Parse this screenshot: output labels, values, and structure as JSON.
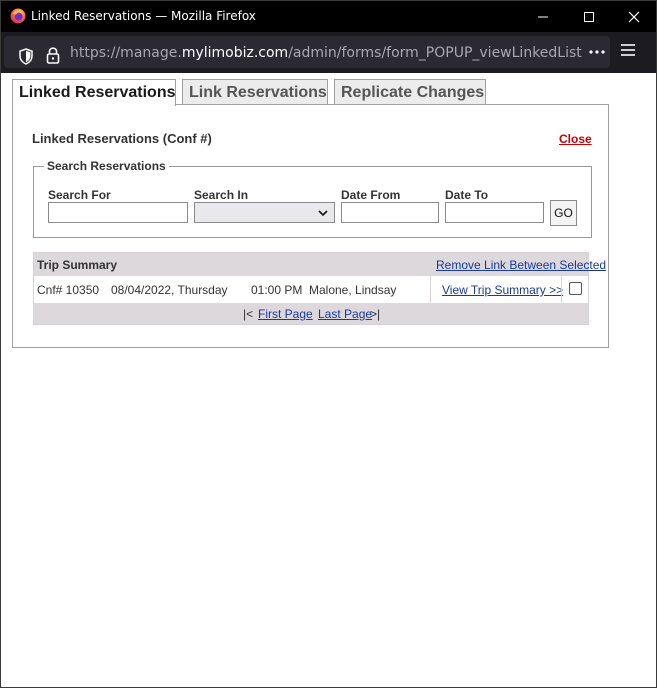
{
  "window": {
    "title": "Linked Reservations — Mozilla Firefox"
  },
  "urlbar": {
    "url_prefix": "https://manage.",
    "url_host": "mylimobiz.com",
    "url_suffix": "/admin/forms/form_POPUP_viewLinkedList.asp?action"
  },
  "tabs": [
    {
      "label": "Linked Reservations",
      "active": true
    },
    {
      "label": "Link Reservations",
      "active": false
    },
    {
      "label": "Replicate Changes",
      "active": false
    }
  ],
  "panel": {
    "title": "Linked Reservations (Conf #)",
    "close_label": "Close"
  },
  "search": {
    "legend": "Search Reservations",
    "search_for_label": "Search For",
    "search_for_value": "",
    "search_in_label": "Search In",
    "search_in_value": "",
    "date_from_label": "Date From",
    "date_from_value": "",
    "date_to_label": "Date To",
    "date_to_value": "",
    "go_label": "GO"
  },
  "results": {
    "header": "Trip Summary",
    "remove_link": "Remove Link Between Selected",
    "rows": [
      {
        "conf": "Cnf# 10350",
        "date": "08/04/2022, Thursday",
        "time": "01:00 PM",
        "name": "Malone, Lindsay",
        "view_link": "View Trip Summary >>",
        "checked": false
      }
    ],
    "pager": {
      "first_prefix": "|<",
      "first_label": "First Page",
      "last_label": "Last Page",
      "last_suffix": ">|"
    }
  },
  "colors": {
    "titlebar_bg": "#000000",
    "urlbar_bg": "#1c1b22",
    "url_field_bg": "#2b2a33",
    "close_link": "#cc0000",
    "link": "#1a3a9a",
    "grid_header_bg": "#dcd8dc"
  },
  "icons": {
    "app": "firefox-logo-icon",
    "tracking": "shield-icon",
    "security": "lock-icon",
    "more": "more-dots-icon",
    "menu": "hamburger-menu-icon"
  }
}
